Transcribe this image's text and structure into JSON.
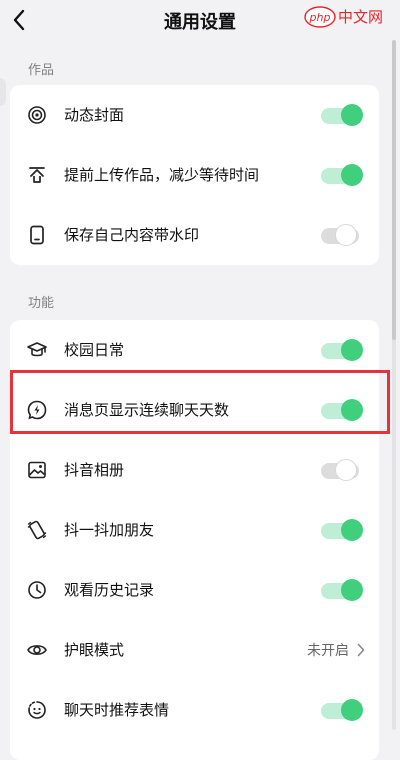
{
  "header": {
    "title": "通用设置",
    "watermark": {
      "logo": "php",
      "text": "中文网"
    }
  },
  "sections": [
    {
      "label": "作品",
      "items": [
        {
          "icon": "live-cover-icon",
          "label": "动态封面",
          "control": "toggle",
          "on": true
        },
        {
          "icon": "upload-arrow-icon",
          "label": "提前上传作品，减少等待时间",
          "control": "toggle",
          "on": true
        },
        {
          "icon": "phone-save-icon",
          "label": "保存自己内容带水印",
          "control": "toggle",
          "on": false
        }
      ]
    },
    {
      "label": "功能",
      "items": [
        {
          "icon": "graduation-cap-icon",
          "label": "校园日常",
          "control": "toggle",
          "on": true
        },
        {
          "icon": "spark-bubble-icon",
          "label": "消息页显示连续聊天天数",
          "control": "toggle",
          "on": true
        },
        {
          "icon": "photo-album-icon",
          "label": "抖音相册",
          "control": "toggle",
          "on": false
        },
        {
          "icon": "shake-phone-icon",
          "label": "抖一抖加朋友",
          "control": "toggle",
          "on": true
        },
        {
          "icon": "clock-icon",
          "label": "观看历史记录",
          "control": "toggle",
          "on": true
        },
        {
          "icon": "eye-icon",
          "label": "护眼模式",
          "control": "link",
          "value": "未开启"
        },
        {
          "icon": "smiley-chat-icon",
          "label": "聊天时推荐表情",
          "control": "toggle",
          "on": true
        }
      ]
    }
  ],
  "colors": {
    "toggle_on": "#3fcf7d",
    "toggle_on_track": "#bfeed7",
    "toggle_off_track": "#dcdcdc",
    "highlight": "#e3343c",
    "background": "#f2f2f4"
  }
}
